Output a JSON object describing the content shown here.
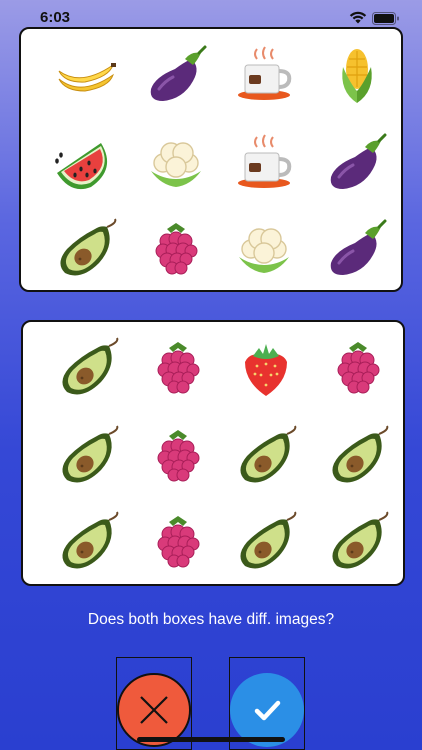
{
  "status": {
    "time": "6:03"
  },
  "box_top": {
    "items": [
      "banana",
      "eggplant",
      "coffee-cup",
      "corn",
      "watermelon",
      "cauliflower",
      "coffee-cup",
      "eggplant",
      "avocado",
      "raspberry",
      "cauliflower",
      "eggplant"
    ]
  },
  "box_bottom": {
    "items": [
      "avocado",
      "raspberry",
      "strawberry",
      "raspberry",
      "avocado",
      "raspberry",
      "avocado",
      "avocado",
      "avocado",
      "raspberry",
      "avocado",
      "avocado"
    ]
  },
  "question": "Does both boxes have diff. images?",
  "buttons": {
    "no_icon": "close-icon",
    "yes_icon": "check-icon"
  },
  "colors": {
    "no": "#ef5a3c",
    "yes": "#2b8fe6"
  }
}
